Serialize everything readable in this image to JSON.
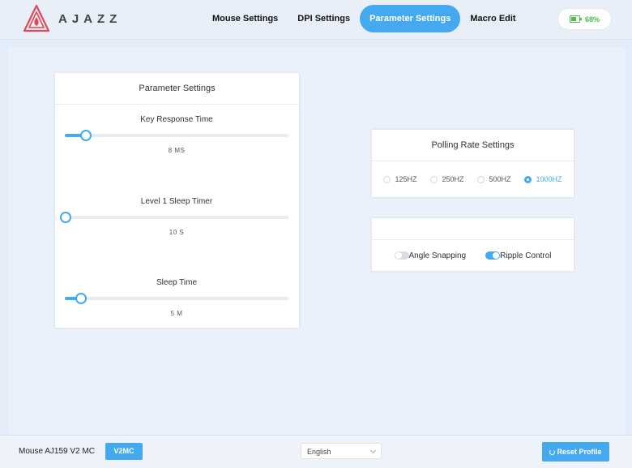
{
  "brand": {
    "name": "AJAZZ"
  },
  "nav": {
    "items": [
      {
        "label": "Mouse Settings"
      },
      {
        "label": "DPI Settings"
      },
      {
        "label": "Parameter Settings",
        "active": true
      },
      {
        "label": "Macro Edit"
      }
    ]
  },
  "battery": {
    "percent_text": "68%",
    "level_percent": 68,
    "color": "#48c04a"
  },
  "parameter_settings": {
    "title": "Parameter Settings",
    "sliders": [
      {
        "label": "Key Response Time",
        "value": "8 MS",
        "level_percent": 9
      },
      {
        "label": "Level 1 Sleep Timer",
        "value": "10 S",
        "level_percent": 0
      },
      {
        "label": "Sleep Time",
        "value": "5 M",
        "level_percent": 7
      }
    ]
  },
  "polling_rate": {
    "title": "Polling Rate Settings",
    "options": [
      "125HZ",
      "250HZ",
      "500HZ",
      "1000HZ"
    ],
    "selected": "1000HZ"
  },
  "toggles": [
    {
      "label": "Angle Snapping",
      "on": false
    },
    {
      "label": "Ripple Control",
      "on": true
    }
  ],
  "footer": {
    "device_name": "Mouse AJ159 V2 MC",
    "firmware_badge": "V2MC",
    "language": "English",
    "reset_label": "Reset Profile"
  },
  "colors": {
    "accent": "#45a9f0",
    "logo": "#e04a52"
  }
}
